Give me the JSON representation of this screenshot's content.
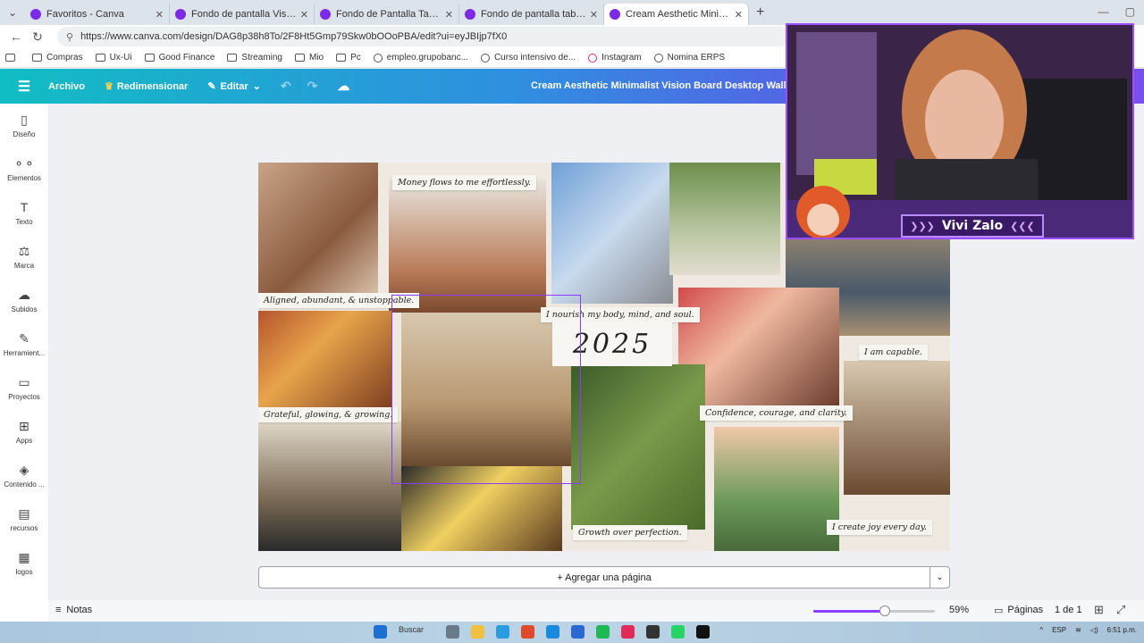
{
  "browser": {
    "tabs": [
      {
        "title": "Favoritos - Canva",
        "active": false
      },
      {
        "title": "Fondo de pantalla Vision board Fo",
        "active": false
      },
      {
        "title": "Fondo de Pantalla Tablero de Visi",
        "active": false
      },
      {
        "title": "Fondo de pantalla tablero de visió",
        "active": false
      },
      {
        "title": "Cream Aesthetic Minimalist Vision",
        "active": true
      }
    ],
    "url": "https://www.canva.com/design/DAG8p38h8To/2F8Ht5Gmp79Skw0bOOoPBA/edit?ui=eyJBIjp7fX0",
    "bookmarks": [
      "Compras",
      "Ux-Ui",
      "Good Finance",
      "Streaming",
      "Mio",
      "Pc",
      "empleo.grupobanc...",
      "Curso intensivo de...",
      "Instagram",
      "Nomina ERPS"
    ]
  },
  "canva_header": {
    "file_label": "Archivo",
    "resize_label": "Redimensionar",
    "edit_label": "Editar",
    "doc_title": "Cream Aesthetic Minimalist Vision Board Desktop Wallpaper"
  },
  "sidebar": {
    "items": [
      {
        "label": "Diseño",
        "icon": "layout-icon"
      },
      {
        "label": "Elementos",
        "icon": "shapes-icon"
      },
      {
        "label": "Texto",
        "icon": "text-icon"
      },
      {
        "label": "Marca",
        "icon": "brand-icon"
      },
      {
        "label": "Subidos",
        "icon": "upload-cloud-icon"
      },
      {
        "label": "Herramient...",
        "icon": "tools-icon"
      },
      {
        "label": "Proyectos",
        "icon": "folder-icon"
      },
      {
        "label": "Apps",
        "icon": "apps-icon"
      },
      {
        "label": "Contenido ...",
        "icon": "content-icon"
      },
      {
        "label": "recursos",
        "icon": "resources-icon"
      },
      {
        "label": "logos",
        "icon": "logos-icon"
      }
    ]
  },
  "board": {
    "notes": [
      "Money flows to me effortlessly.",
      "Aligned, abundant, & unstoppable.",
      "I nourish my body, mind, and soul.",
      "I am capable.",
      "Grateful, glowing, & growing.",
      "Confidence, courage, and clarity.",
      "Growth over perfection.",
      "I create joy every day."
    ],
    "year": "2025"
  },
  "add_page_label": "+ Agregar una página",
  "footer": {
    "notes_label": "Notas",
    "zoom": "59%",
    "zoom_value": 59,
    "pages_label": "Páginas",
    "page_count": "1 de 1"
  },
  "taskbar": {
    "search_label": "Buscar",
    "lang": "ESP",
    "time": "6:51 p.m."
  },
  "webcam": {
    "streamer_name": "Vivi Zalo"
  },
  "colors": {
    "accent": "#8b3dff",
    "canva_gradient_start": "#11bdc4",
    "canva_gradient_end": "#7a4ff0"
  }
}
